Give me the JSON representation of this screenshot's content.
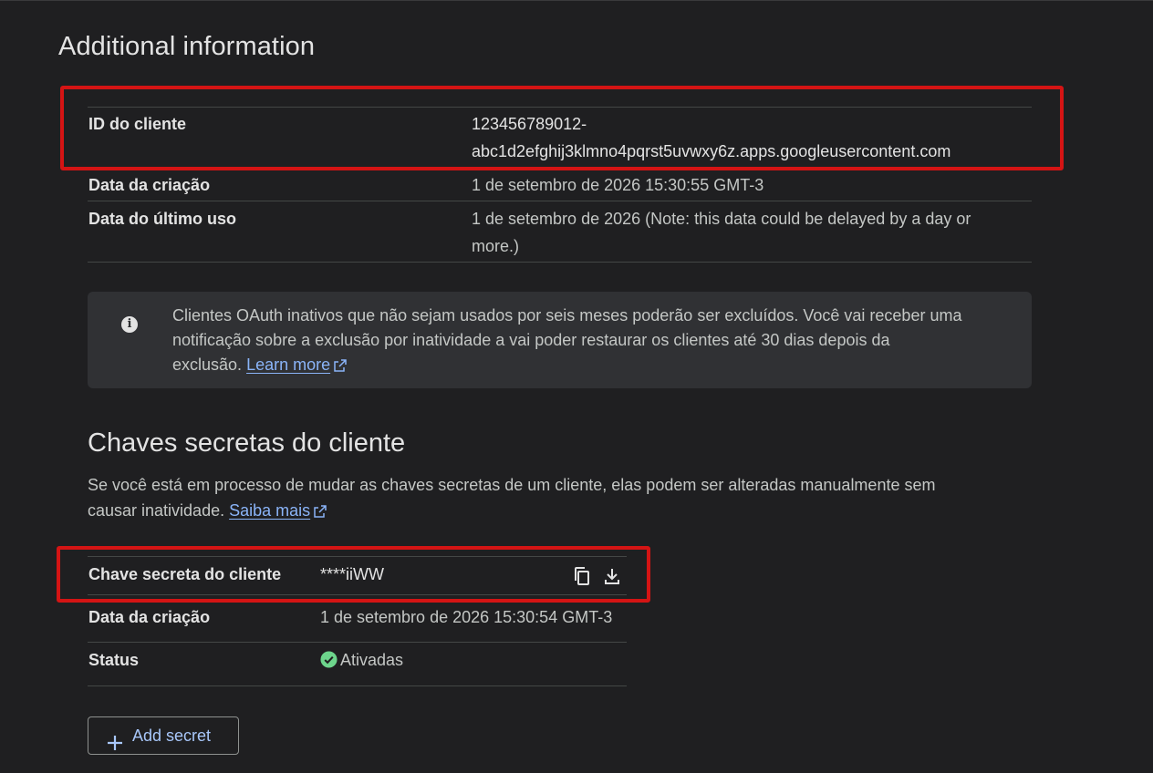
{
  "section": {
    "title": "Additional information"
  },
  "client_info": {
    "rows": [
      {
        "label": "ID do cliente",
        "value_line1": "123456789012-",
        "value_line2": "abc1d2efghij3klmno4pqrst5uvwxy6z.apps.googleusercontent.com"
      },
      {
        "label": "Data da criação",
        "value": "1 de setembro de 2026 15:30:55 GMT-3"
      },
      {
        "label": "Data do último uso",
        "value_line1": "1 de setembro de 2026 (Note: this data could be delayed by a day or",
        "value_line2": "more.)"
      }
    ]
  },
  "notice": {
    "text_line1": "Clientes OAuth inativos que não sejam usados por seis meses poderão ser excluídos. Você vai receber uma",
    "text_line2": "notificação sobre a exclusão por inatividade a vai poder restaurar os clientes até 30 dias depois da",
    "text_line3": "exclusão.",
    "link": "Learn more"
  },
  "secrets": {
    "title": "Chaves secretas do cliente",
    "desc_line1": "Se você está em processo de mudar as chaves secretas de um cliente, elas podem ser alteradas manualmente sem",
    "desc_line2": "causar inatividade.",
    "link": "Saiba mais",
    "rows": [
      {
        "label": "Chave secreta do cliente",
        "value": "****iiWW"
      },
      {
        "label": "Data da criação",
        "value": "1 de setembro de 2026 15:30:54 GMT-3"
      },
      {
        "label": "Status",
        "value": "Ativadas"
      }
    ],
    "add_button": "Add secret"
  },
  "colors": {
    "background": "#1f1f21",
    "highlight": "#d41414",
    "link": "#8ab4f8",
    "status_ok": "#6dd58c"
  },
  "icons": [
    "info-icon",
    "external-link-icon",
    "copy-icon",
    "download-icon",
    "check-circle-icon",
    "plus-icon"
  ]
}
